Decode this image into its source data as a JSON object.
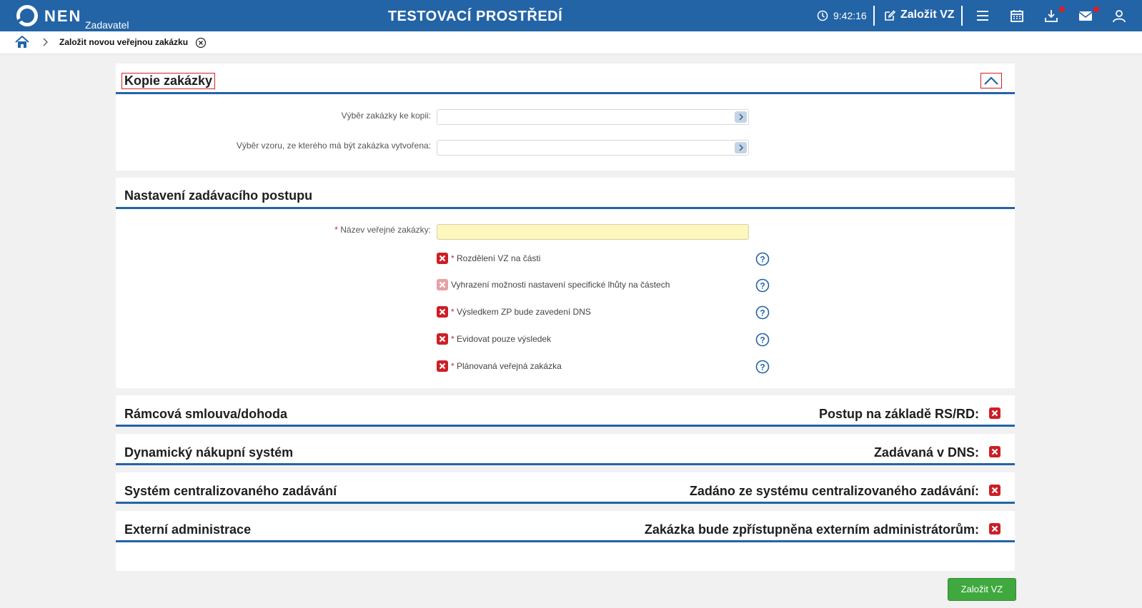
{
  "header": {
    "brand": "NEN",
    "role": "Zadavatel",
    "environment": "TESTOVACÍ PROSTŘEDÍ",
    "time": "9:42:16",
    "new_vz": "Založit VZ",
    "brand_color": "#2364a6",
    "icons": [
      "clock-icon",
      "edit-icon",
      "menu-icon",
      "calendar-icon",
      "download-icon",
      "mail-icon",
      "user-icon"
    ]
  },
  "breadcrumb": {
    "page": "Založit novou veřejnou zakázku"
  },
  "copy_section": {
    "title": "Kopie zakázky",
    "fields": [
      {
        "label": "Výběr zakázky ke kopii:",
        "value": ""
      },
      {
        "label": "Výběr vzoru, ze kterého má být zakázka vytvořena:",
        "value": ""
      }
    ]
  },
  "procedure_section": {
    "title": "Nastavení zadávacího postupu",
    "name_label": "Název veřejné zakázky:",
    "name_value": "",
    "checkboxes": [
      {
        "label": "Rozdělení VZ na části",
        "required": true,
        "checked": false,
        "disabled": false
      },
      {
        "label": "Vyhrazení možnosti nastavení specifické lhůty na částech",
        "required": false,
        "checked": false,
        "disabled": true
      },
      {
        "label": "Výsledkem ZP bude zavedení DNS",
        "required": true,
        "checked": false,
        "disabled": false
      },
      {
        "label": "Evidovat pouze výsledek",
        "required": true,
        "checked": false,
        "disabled": false
      },
      {
        "label": "Plánovaná veřejná zakázka",
        "required": true,
        "checked": false,
        "disabled": false
      }
    ]
  },
  "collapsed_sections": [
    {
      "title": "Rámcová smlouva/dohoda",
      "right_label": "Postup na základě RS/RD:",
      "checked": false
    },
    {
      "title": "Dynamický nákupní systém",
      "right_label": "Zadávaná v DNS:",
      "checked": false
    },
    {
      "title": "Systém centralizovaného zadávání",
      "right_label": "Zadáno ze systému centralizovaného zadávání:",
      "checked": false
    },
    {
      "title": "Externí administrace",
      "right_label": "Zakázka bude zpřístupněna externím administrátorům:",
      "checked": false
    }
  ],
  "actions": {
    "submit_label": "Založit VZ",
    "submit_color": "#3fa93f"
  },
  "required_marker": "*"
}
